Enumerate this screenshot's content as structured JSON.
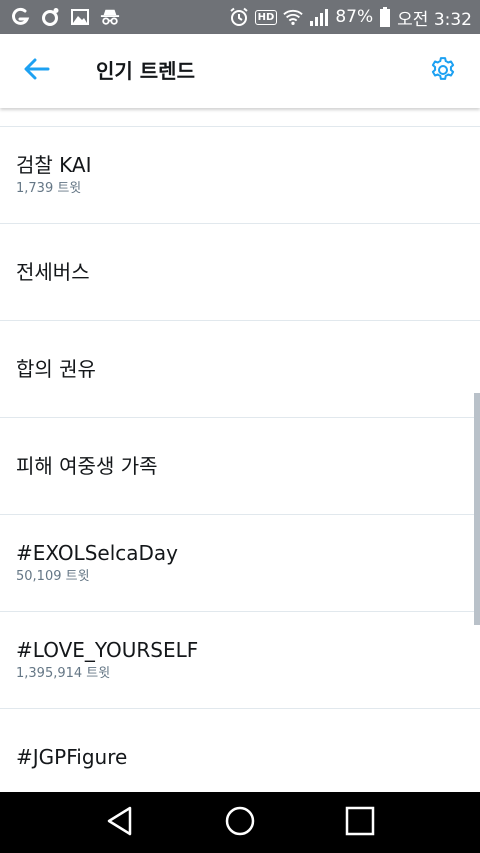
{
  "status_bar": {
    "battery": "87%",
    "time": "오전 3:32",
    "hd_label": "HD",
    "icons": [
      "g-app-icon",
      "camera-app-icon",
      "gallery-icon",
      "spy-icon",
      "alarm-icon",
      "hd-icon",
      "wifi-icon",
      "signal-icon",
      "battery-icon"
    ]
  },
  "app_bar": {
    "title": "인기 트렌드",
    "back_icon": "arrow-left-icon",
    "settings_icon": "gear-icon",
    "accent_color": "#1da1f2"
  },
  "trends": [
    {
      "name": "검찰 KAI",
      "count": "1,739 트윗"
    },
    {
      "name": "전세버스",
      "count": ""
    },
    {
      "name": "합의 권유",
      "count": ""
    },
    {
      "name": "피해 여중생 가족",
      "count": ""
    },
    {
      "name": "#EXOLSelcaDay",
      "count": "50,109 트윗"
    },
    {
      "name": "#LOVE_YOURSELF",
      "count": "1,395,914 트윗"
    },
    {
      "name": "#JGPFigure",
      "count": ""
    }
  ],
  "nav_bar": {
    "icons": [
      "back-triangle-icon",
      "home-circle-icon",
      "recents-square-icon"
    ]
  }
}
